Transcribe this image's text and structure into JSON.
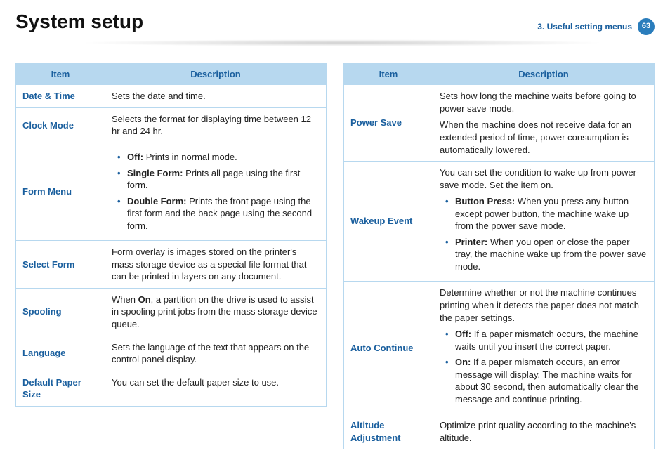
{
  "header": {
    "title": "System setup",
    "chapter": "3.  Useful setting menus",
    "page": "63"
  },
  "left": {
    "headers": {
      "item": "Item",
      "desc": "Description"
    },
    "rows": {
      "datetime": {
        "item": "Date & Time",
        "desc": "Sets the date and time."
      },
      "clock": {
        "item": "Clock Mode",
        "desc": "Selects the format for displaying time between 12 hr and 24 hr."
      },
      "form": {
        "item": "Form Menu",
        "off_bold": "Off:",
        "off_rest": " Prints in normal mode.",
        "single_bold": "Single Form:",
        "single_rest": " Prints all page using the first form.",
        "double_bold": "Double Form:",
        "double_rest": " Prints the front page using the first form and the back page using the second form."
      },
      "select": {
        "item": "Select Form",
        "desc": "Form overlay is images stored on the printer's mass storage device as a special file format that can be printed in layers on any document."
      },
      "spool": {
        "item": "Spooling",
        "pre": "When ",
        "bold": "On",
        "post": ", a partition on the drive is used to assist in spooling print jobs from the mass storage device queue."
      },
      "lang": {
        "item": "Language",
        "desc": "Sets the language of the text that appears on the control panel display."
      },
      "paper": {
        "item": "Default Paper Size",
        "desc": "You can set the default paper size to use."
      }
    }
  },
  "right": {
    "headers": {
      "item": "Item",
      "desc": "Description"
    },
    "rows": {
      "power": {
        "item": "Power Save",
        "p1": "Sets how long the machine waits before going to power save mode.",
        "p2": "When the machine does not receive data for an extended period of time, power consumption is automatically lowered."
      },
      "wake": {
        "item": "Wakeup Event",
        "intro": "You can set the condition to wake up from power-save mode. Set the item on.",
        "btn_bold": "Button Press: ",
        "btn_rest": " When you press any button except power button, the machine wake up from the power save mode.",
        "prn_bold": "Printer:",
        "prn_rest": " When you open or close the paper tray, the machine wake up from the power save mode."
      },
      "auto": {
        "item": "Auto Continue",
        "intro": "Determine whether or not the machine continues printing when it detects the paper does not match the paper settings.",
        "off_bold": "Off:",
        "off_rest": " If a paper mismatch occurs, the machine waits until you insert the correct paper.",
        "on_bold": "On:",
        "on_rest": " If a paper mismatch occurs, an error message will display. The machine waits for about 30 second, then automatically clear the message and continue printing."
      },
      "alt": {
        "item": "Altitude Adjustment",
        "desc": "Optimize print quality according to the machine's altitude."
      }
    }
  }
}
